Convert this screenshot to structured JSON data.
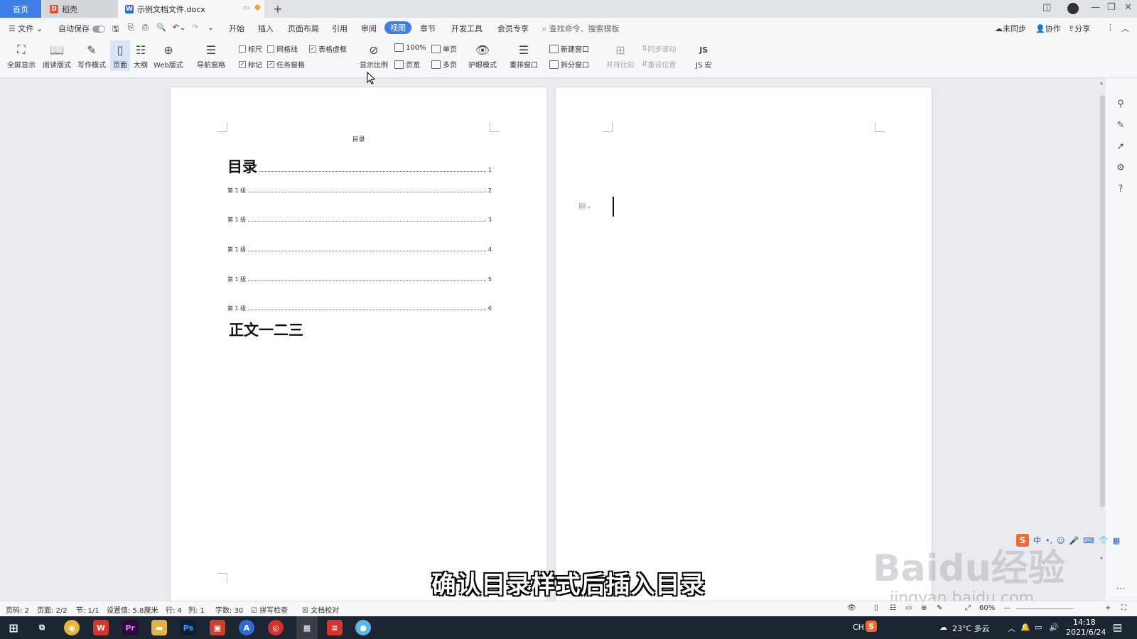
{
  "tabs": {
    "home": "首页",
    "daoke": "稻壳",
    "doc": "示例文档文件.docx"
  },
  "menu": {
    "file": "文件",
    "autosave": "自动保存",
    "items": [
      "开始",
      "插入",
      "页面布局",
      "引用",
      "审阅",
      "视图",
      "章节",
      "开发工具",
      "会员专享"
    ],
    "active": "视图",
    "search_placeholder": "查找命令、搜索模板",
    "unsynced": "未同步",
    "collab": "协作",
    "share": "分享"
  },
  "ribbon": {
    "fullscreen": "全屏显示",
    "reading": "阅读版式",
    "writing": "写作模式",
    "page": "页面",
    "outline": "大纲",
    "web": "Web版式",
    "nav_pane": "导航窗格",
    "ruler": "标尺",
    "gridlines": "网格线",
    "table_gridlines": "表格虚框",
    "marks": "标记",
    "task_pane": "任务窗格",
    "zoom": "显示比例",
    "zoom100": "100%",
    "single_page": "单页",
    "page_width": "页宽",
    "multi_page": "多页",
    "eye_care": "护眼模式",
    "rearrange": "重排窗口",
    "new_window": "新建窗口",
    "split_window": "拆分窗口",
    "side_by_side": "并排比较",
    "sync_scroll": "同步滚动",
    "reset_position": "重设位置",
    "js_macro": "JS 宏"
  },
  "document": {
    "header": "目录",
    "toc_title": "目录",
    "toc_title_page": "1",
    "toc_entries": [
      {
        "label": "第 1 级",
        "page": "2"
      },
      {
        "label": "第 1 级",
        "page": "3"
      },
      {
        "label": "第 1 级",
        "page": "4"
      },
      {
        "label": "第 1 级",
        "page": "5"
      },
      {
        "label": "第 1 级",
        "page": "6"
      }
    ],
    "body": "正文一二三"
  },
  "status": {
    "page_no": "页码: 2",
    "pages": "页面: 2/2",
    "section": "节: 1/1",
    "setting": "设置值: 5.8厘米",
    "row": "行: 4",
    "col": "列: 1",
    "words": "字数: 30",
    "spell": "拼写检查",
    "proof": "文档校对",
    "zoom": "60%"
  },
  "ime": {
    "lang": "中"
  },
  "subtitle": "确认目录样式后插入目录",
  "watermark": {
    "brand": "Baidu经验",
    "url": "jingyan.baidu.com"
  },
  "taskbar": {
    "lang": "CH",
    "weather": "23°C 多云",
    "time": "14:18",
    "date": "2021/6/24"
  },
  "colors": {
    "accent": "#3d7fe7",
    "taskbar": "#1c2532"
  }
}
